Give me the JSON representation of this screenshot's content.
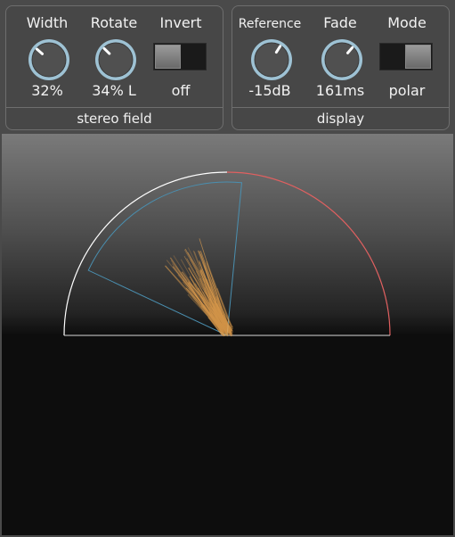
{
  "stereo_field": {
    "title": "stereo field",
    "width": {
      "label": "Width",
      "value": "32%",
      "level": 0.32
    },
    "rotate": {
      "label": "Rotate",
      "value": "34% L",
      "level": 0.33
    },
    "invert": {
      "label": "Invert",
      "value": "off"
    }
  },
  "display": {
    "title": "display",
    "reference": {
      "label": "Reference",
      "value": "-15dB",
      "level": 0.62
    },
    "fade": {
      "label": "Fade",
      "value": "161ms",
      "level": 0.65
    },
    "mode": {
      "label": "Mode",
      "value": "polar"
    }
  },
  "colors": {
    "knob_ring": "#9ec2d4",
    "arc_left": "#ffffff",
    "arc_right": "#e06060",
    "sector": "#4a8fb0",
    "trace": "#f0a850"
  }
}
